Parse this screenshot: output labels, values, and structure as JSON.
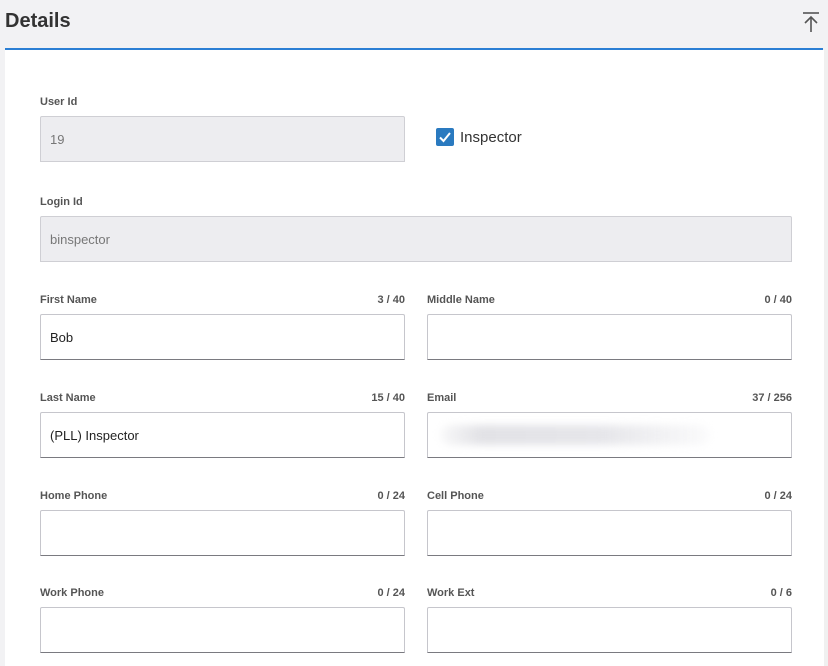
{
  "header": {
    "title": "Details",
    "collapse_icon": "collapse-to-top-icon"
  },
  "colors": {
    "accent": "#2b7fd4",
    "checkbox": "#2a7ac0"
  },
  "user_id": {
    "label": "User Id",
    "value": "19"
  },
  "inspector": {
    "label": "Inspector",
    "checked": true
  },
  "login_id": {
    "label": "Login Id",
    "value": "binspector"
  },
  "first_name": {
    "label": "First Name",
    "counter": "3 / 40",
    "value": "Bob"
  },
  "middle_name": {
    "label": "Middle Name",
    "counter": "0 / 40",
    "value": ""
  },
  "last_name": {
    "label": "Last Name",
    "counter": "15 / 40",
    "value": "(PLL) Inspector"
  },
  "email": {
    "label": "Email",
    "counter": "37 / 256",
    "value": ""
  },
  "home_phone": {
    "label": "Home Phone",
    "counter": "0 / 24",
    "value": ""
  },
  "cell_phone": {
    "label": "Cell Phone",
    "counter": "0 / 24",
    "value": ""
  },
  "work_phone": {
    "label": "Work Phone",
    "counter": "0 / 24",
    "value": ""
  },
  "work_ext": {
    "label": "Work Ext",
    "counter": "0 / 6",
    "value": ""
  }
}
